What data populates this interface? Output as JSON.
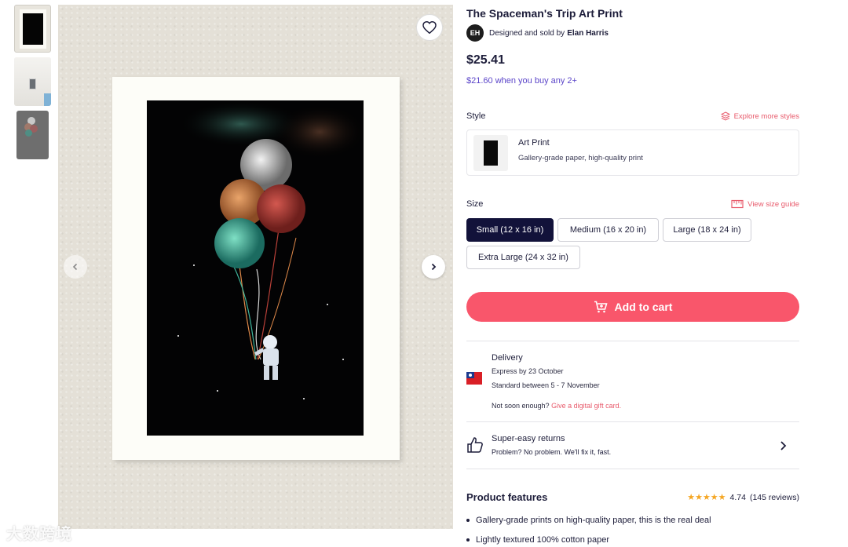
{
  "product": {
    "title": "The Spaceman's Trip Art Print",
    "artist_prefix": "Designed and sold by",
    "artist_name": "Elan Harris",
    "artist_initials": "EH",
    "price": "$25.41",
    "bulk_offer": "$21.60 when you buy any 2+"
  },
  "style": {
    "label": "Style",
    "explore_link": "Explore more styles",
    "selected_name": "Art Print",
    "selected_desc": "Gallery-grade paper, high-quality print"
  },
  "size": {
    "label": "Size",
    "guide_link": "View size guide",
    "options": [
      "Small (12 x 16 in)",
      "Medium (16 x 20 in)",
      "Large (18 x 24 in)",
      "Extra Large (24 x 32 in)"
    ],
    "selected_index": 0
  },
  "cart": {
    "label": "Add to cart"
  },
  "delivery": {
    "title": "Delivery",
    "express": "Express by 23 October",
    "standard": "Standard between 5 - 7 November",
    "not_soon": "Not soon enough?",
    "gift_link": "Give a digital gift card."
  },
  "returns": {
    "title": "Super-easy returns",
    "subtitle": "Problem? No problem. We'll fix it, fast."
  },
  "features": {
    "title": "Product features",
    "rating": "4.74",
    "reviews": "(145 reviews)",
    "stars": "★★★★★",
    "items": [
      "Gallery-grade prints on high-quality paper, this is the real deal",
      "Lightly textured 100% cotton paper"
    ]
  },
  "watermark": "大数跨境",
  "colors": {
    "accent": "#f9566b",
    "link": "#e85a6b",
    "active_size": "#12123a",
    "bulk_offer": "#5b45c9"
  }
}
